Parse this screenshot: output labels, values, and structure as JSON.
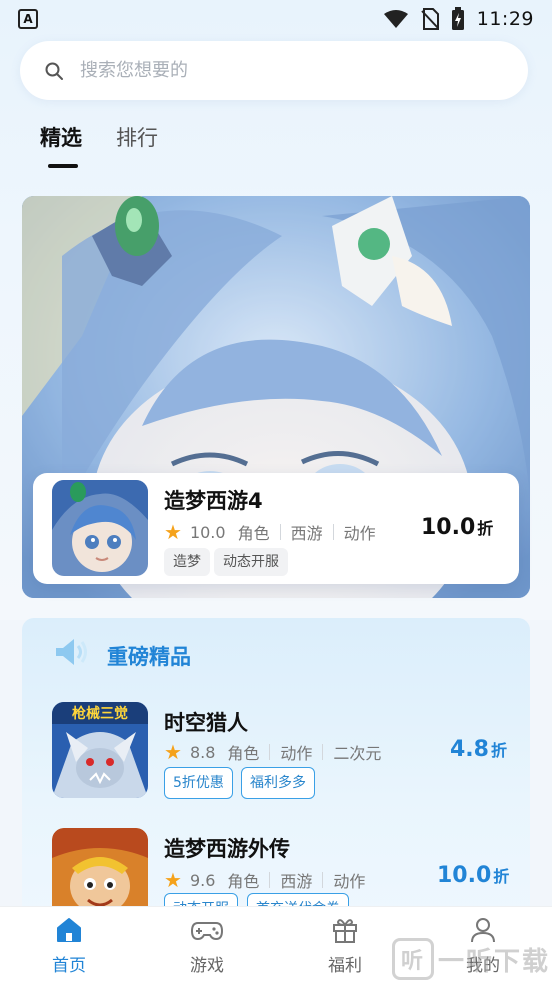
{
  "status_bar": {
    "time": "11:29",
    "left_icon": "A",
    "icons": [
      "wifi-icon",
      "no-sim-icon",
      "battery-charging-icon"
    ]
  },
  "search": {
    "placeholder": "搜索您想要的",
    "icon": "search-icon"
  },
  "tabs": [
    {
      "label": "精选",
      "active": true
    },
    {
      "label": "排行",
      "active": false
    }
  ],
  "banner": {
    "game": {
      "title": "造梦西游4",
      "rating": "10.0",
      "genres": [
        "角色",
        "西游",
        "动作"
      ],
      "tags": [
        "造梦",
        "动态开服"
      ],
      "discount_num": "10.0",
      "discount_unit": "折"
    }
  },
  "section": {
    "icon": "speaker-icon",
    "title": "重磅精品",
    "games": [
      {
        "title": "时空猎人",
        "rating": "8.8",
        "genres": [
          "角色",
          "动作",
          "二次元"
        ],
        "tags": [
          "5折优惠",
          "福利多多"
        ],
        "discount_num": "4.8",
        "discount_unit": "折",
        "thumb_text": "枪械三觉"
      },
      {
        "title": "造梦西游外传",
        "rating": "9.6",
        "genres": [
          "角色",
          "西游",
          "动作"
        ],
        "tags": [
          "动态开服",
          "首充送代金券"
        ],
        "discount_num": "10.0",
        "discount_unit": "折"
      }
    ]
  },
  "bottom_nav": [
    {
      "label": "首页",
      "icon": "home-icon",
      "active": true
    },
    {
      "label": "游戏",
      "icon": "gamepad-icon",
      "active": false
    },
    {
      "label": "福利",
      "icon": "gift-icon",
      "active": false
    },
    {
      "label": "我的",
      "icon": "user-icon",
      "active": false
    }
  ],
  "watermark": {
    "text": "一听下载",
    "icon_text": "听"
  },
  "colors": {
    "accent": "#2184d6",
    "star": "#f5a21b",
    "tag_border": "#3aa0e6"
  }
}
